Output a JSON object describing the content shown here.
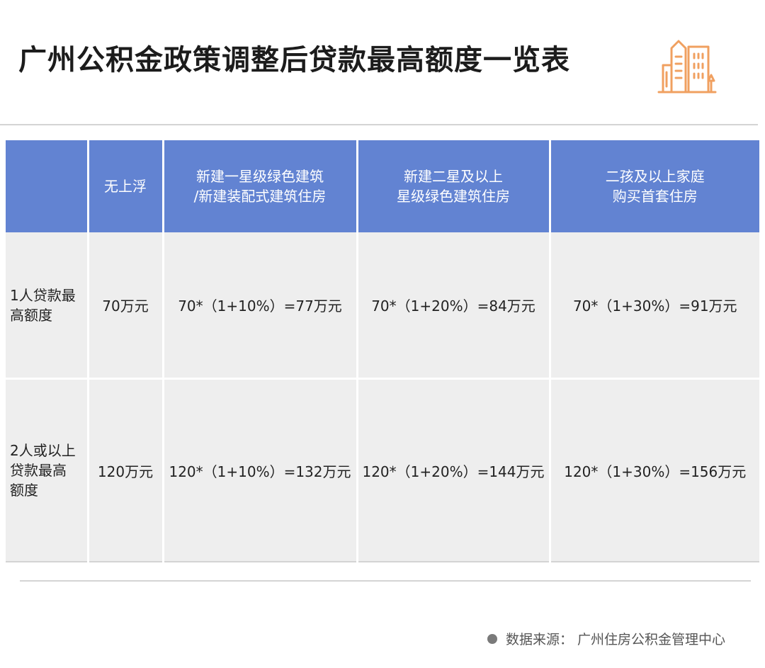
{
  "title": "广州公积金政策调整后贷款最高额度一览表",
  "colors": {
    "header_blue": "#6283d2",
    "cell_gray": "#eeeeee",
    "icon_orange": "#f0a060"
  },
  "icons": {
    "header": "building-icon",
    "source": "dot-icon"
  },
  "table": {
    "headers": [
      {
        "lines": [
          ""
        ]
      },
      {
        "lines": [
          "无上浮"
        ]
      },
      {
        "lines": [
          "新建一星级绿色建筑",
          "/新建装配式建筑住房"
        ]
      },
      {
        "lines": [
          "新建二星及以上",
          "星级绿色建筑住房"
        ]
      },
      {
        "lines": [
          "二孩及以上家庭",
          "购买首套住房"
        ]
      }
    ],
    "rows": [
      {
        "label": [
          "1人贷款最",
          "高额度"
        ],
        "cells": [
          "70万元",
          "70*（1+10%）=77万元",
          "70*（1+20%）=84万元",
          "70*（1+30%）=91万元"
        ]
      },
      {
        "label": [
          "2人或以上",
          "贷款最高",
          "额度"
        ],
        "cells": [
          "120万元",
          "120*（1+10%）=132万元",
          "120*（1+20%）=144万元",
          "120*（1+30%）=156万元"
        ]
      }
    ]
  },
  "source": "数据来源：  广州住房公积金管理中心"
}
